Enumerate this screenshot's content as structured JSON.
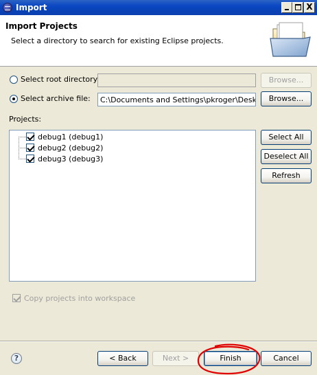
{
  "window": {
    "title": "Import",
    "controls": {
      "minimize": "_",
      "maximize": "□",
      "close": "X"
    }
  },
  "header": {
    "title": "Import Projects",
    "description": "Select a directory to search for existing Eclipse projects."
  },
  "source": {
    "root_directory_label": "Select root directory:",
    "root_directory_value": "",
    "root_directory_selected": false,
    "root_browse_label": "Browse...",
    "archive_file_label": "Select archive file:",
    "archive_file_value": "C:\\Documents and Settings\\pkroger\\Desktop\\",
    "archive_file_selected": true,
    "archive_browse_label": "Browse..."
  },
  "projects": {
    "label": "Projects:",
    "items": [
      {
        "label": "debug1 (debug1)",
        "checked": true
      },
      {
        "label": "debug2 (debug2)",
        "checked": true
      },
      {
        "label": "debug3 (debug3)",
        "checked": true
      }
    ],
    "select_all_label": "Select All",
    "deselect_all_label": "Deselect All",
    "refresh_label": "Refresh"
  },
  "options": {
    "copy_into_workspace_label": "Copy projects into workspace",
    "copy_into_workspace_checked": true,
    "copy_into_workspace_enabled": false
  },
  "footer": {
    "help_icon": "help-icon",
    "help_glyph": "?",
    "back_label": "< Back",
    "next_label": "Next >",
    "finish_label": "Finish",
    "cancel_label": "Cancel"
  },
  "colors": {
    "titlebar": "#0A47C2",
    "dialog_background": "#ECE9D8",
    "annotation_red": "#E00000"
  }
}
